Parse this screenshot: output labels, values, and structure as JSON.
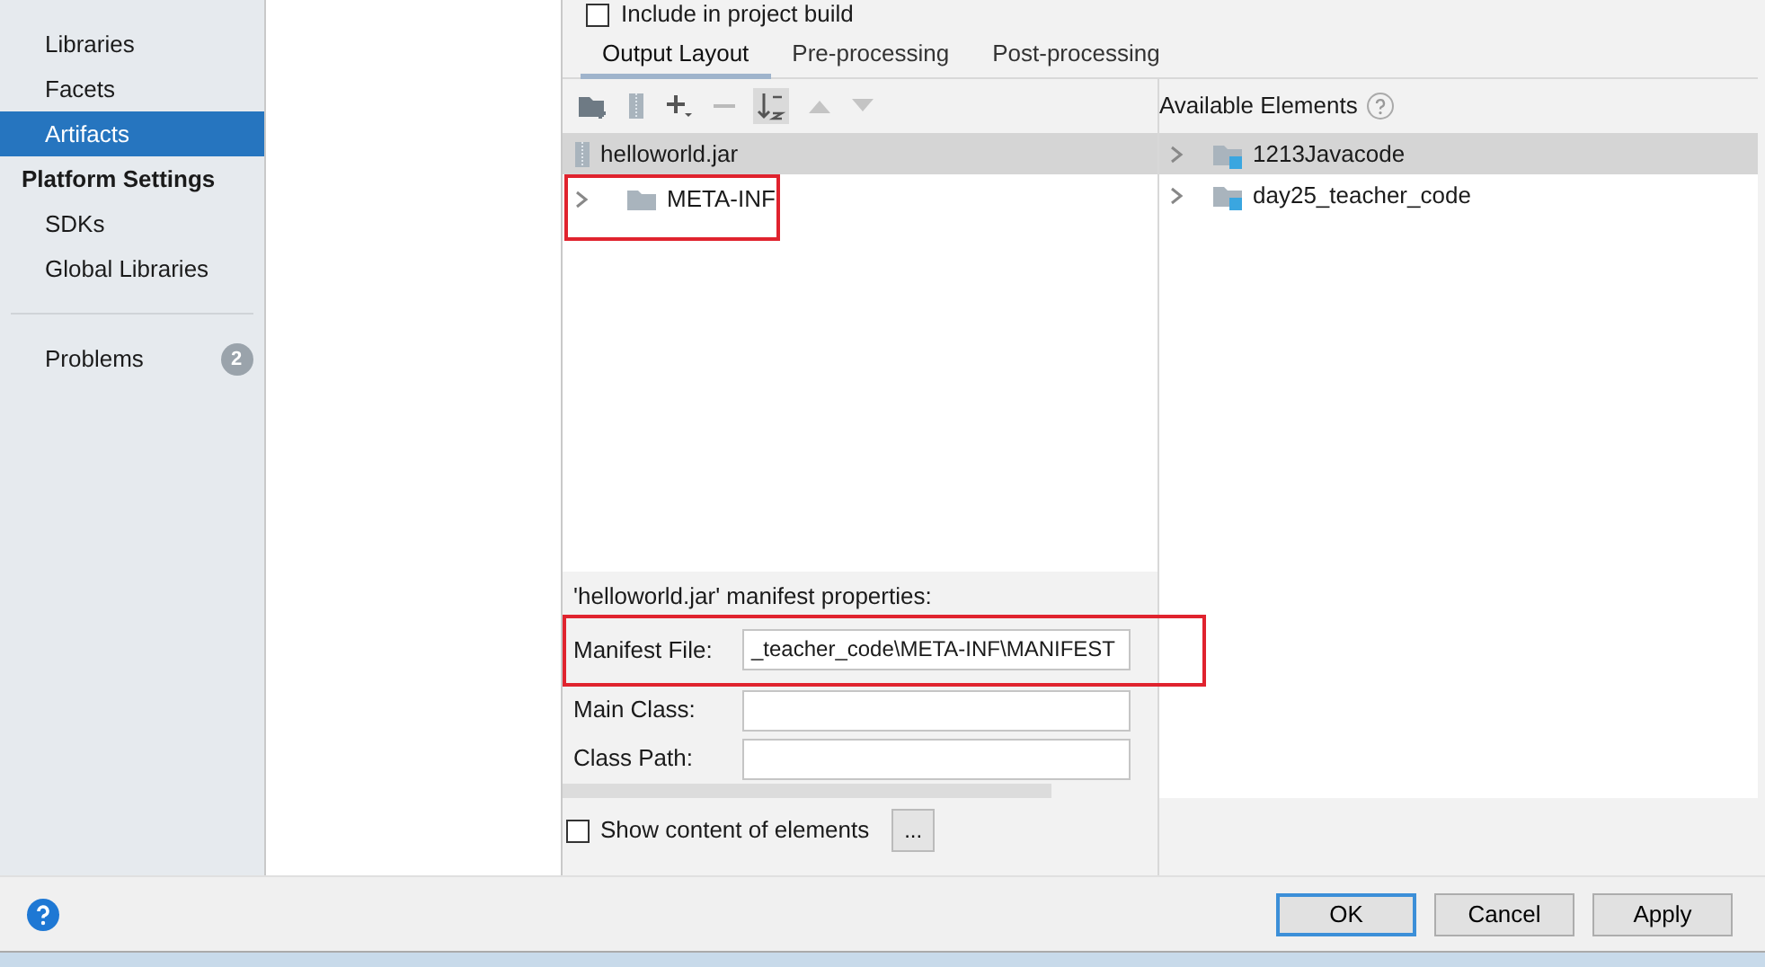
{
  "sidebar": {
    "items": [
      {
        "label": "Libraries",
        "kind": "item",
        "selected": false
      },
      {
        "label": "Facets",
        "kind": "item",
        "selected": false
      },
      {
        "label": "Artifacts",
        "kind": "item",
        "selected": true
      },
      {
        "label": "Platform Settings",
        "kind": "header",
        "selected": false
      },
      {
        "label": "SDKs",
        "kind": "item",
        "selected": false
      },
      {
        "label": "Global Libraries",
        "kind": "item",
        "selected": false
      },
      {
        "label": "Problems",
        "kind": "problems",
        "selected": false,
        "badge": "2"
      }
    ]
  },
  "build_option": {
    "label": "Include in project build",
    "checked": false
  },
  "tabs": [
    {
      "label": "Output Layout",
      "selected": true
    },
    {
      "label": "Pre-processing",
      "selected": false
    },
    {
      "label": "Post-processing",
      "selected": false
    }
  ],
  "output_tree": [
    {
      "label": "helloworld.jar",
      "kind": "jar",
      "selected": true,
      "children": [
        {
          "label": "META-INF",
          "kind": "folder",
          "selected": false,
          "expanded": false
        }
      ]
    }
  ],
  "available_elements": {
    "title": "Available Elements",
    "items": [
      {
        "label": "1213Javacode",
        "selected": true,
        "expanded": false
      },
      {
        "label": "day25_teacher_code",
        "selected": false,
        "expanded": false
      }
    ]
  },
  "manifest": {
    "title": "'helloworld.jar' manifest properties:",
    "fields": [
      {
        "label": "Manifest File:",
        "value": "_teacher_code\\META-INF\\MANIFEST"
      },
      {
        "label": "Main Class:"
      },
      {
        "label": "Class Path:"
      }
    ]
  },
  "show_content": {
    "label": "Show content of elements",
    "checked": false,
    "button": "..."
  },
  "buttons": [
    {
      "label": "OK",
      "default": true
    },
    {
      "label": "Cancel",
      "default": false
    },
    {
      "label": "Apply",
      "default": false
    }
  ]
}
